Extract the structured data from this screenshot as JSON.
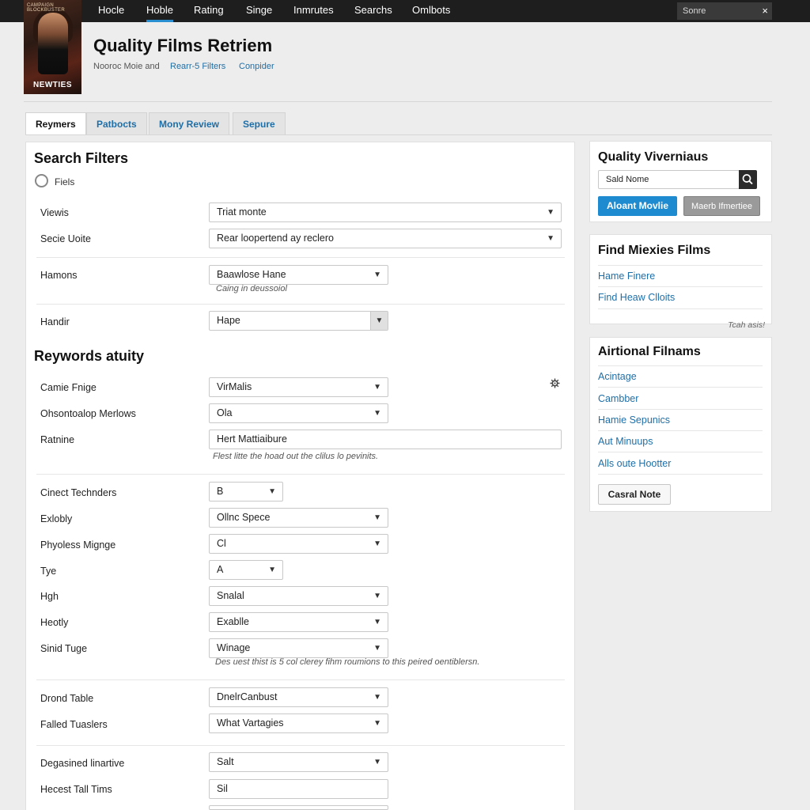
{
  "nav": {
    "items": [
      "Hocle",
      "Hoble",
      "Rating",
      "Singe",
      "Inmrutes",
      "Searchs",
      "Omlbots"
    ],
    "active_index": 1,
    "search_placeholder": "Sonre",
    "close_glyph": "×"
  },
  "poster": {
    "tagline": "CAMPAIGN  BLOCKBUSTER",
    "title": "NEWTIES"
  },
  "header": {
    "title": "Quality Films Retriem",
    "sub_static": "Nooroc Moie and",
    "sub_link_1": "Rearr-5  Filters",
    "sub_link_2": "Conpider"
  },
  "tabs": [
    "Reymers",
    "Patbocts",
    "Mony Review",
    "Sepure"
  ],
  "filters": {
    "title": "Search Filters",
    "radio_label": "Fiels",
    "rows": [
      {
        "label": "Viewis",
        "value": "Triat monte"
      },
      {
        "label": "Secie Uoite",
        "value": "Rear loopertend ay reclero"
      },
      {
        "label": "Hamons",
        "value": "Baawlose Hane",
        "hint": "Caing in deussoiol"
      },
      {
        "label": "Handir",
        "value": "Hape"
      }
    ]
  },
  "keywords": {
    "title": "Reywords atuity",
    "rows": [
      {
        "label": "Camie Fnige",
        "value": "VirMalis"
      },
      {
        "label": "Ohsontoalop Merlows",
        "value": "Ola"
      },
      {
        "label": "Ratnine",
        "value": "Hert Mattiaibure",
        "hint": "Flest litte the hoad out the clilus lo pevinits."
      }
    ],
    "gear_icon": "gear-icon"
  },
  "details": {
    "rows": [
      {
        "label": "Cinect Technders",
        "value": "B"
      },
      {
        "label": "Exlobly",
        "value": "Ollnc Spece"
      },
      {
        "label": "Phyoless Mignge",
        "value": "Cl"
      },
      {
        "label": "Tye",
        "value": "A"
      },
      {
        "label": "Hgh",
        "value": "Snalal"
      },
      {
        "label": "Heotly",
        "value": "Exablle"
      },
      {
        "label": "Sinid Tuge",
        "value": "Winage",
        "hint": "Des uest thist is 5 col clerey fihm roumions to this peired oentiblersn."
      }
    ]
  },
  "extra": {
    "rows": [
      {
        "label": "Drond Table",
        "value": "DnelrCanbust"
      },
      {
        "label": "Falled Tuaslers",
        "value": "What Vartagies"
      },
      {
        "label": "Degasined linartive",
        "value": "Salt"
      },
      {
        "label": "Hecest Tall Tims",
        "value": "Sil"
      }
    ]
  },
  "sidebar": {
    "box1": {
      "title": "Quality Viverniaus",
      "search_value": "Sald Nome",
      "btn_primary": "Aloant Movlie",
      "btn_secondary": "Maerb Ifmertiee"
    },
    "box2": {
      "title": "Find Miexies Films",
      "links": [
        "Hame Finere",
        "Find Heaw Clloits"
      ],
      "footer": "Tcah asis!"
    },
    "box3": {
      "title": "Airtional Filnams",
      "links": [
        "Acintage",
        "Cambber",
        "Hamie Sepunics",
        "Aut Minuups",
        "Alls oute Hootter"
      ],
      "button": "Casral Note"
    }
  }
}
